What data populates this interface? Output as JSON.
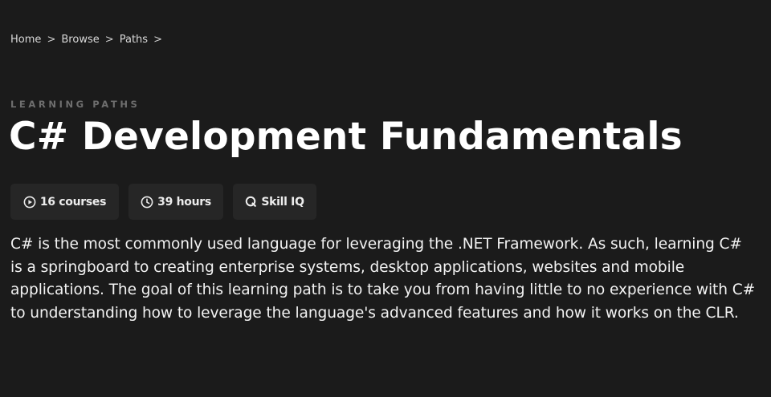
{
  "breadcrumb": {
    "items": [
      "Home",
      "Browse",
      "Paths"
    ],
    "separator": ">"
  },
  "eyebrow": "LEARNING PATHS",
  "title": "C# Development Fundamentals",
  "stats": {
    "courses": "16 courses",
    "hours": "39 hours",
    "skill": "Skill IQ"
  },
  "icons": {
    "courses": "play-circle-icon",
    "hours": "clock-icon",
    "skill": "skill-iq-icon"
  },
  "description": "C# is the most commonly used language for leveraging the .NET Framework. As such, learning C# is a springboard to creating enterprise systems, desktop applications, websites and mobile applications. The goal of this learning path is to take you from having little to no experience with C# to understanding how to leverage the language's advanced features and how it works on the CLR.",
  "colors": {
    "background": "#1b1b1b",
    "chip_background": "#262626",
    "eyebrow": "#6e6e6e",
    "text": "#ffffff"
  }
}
